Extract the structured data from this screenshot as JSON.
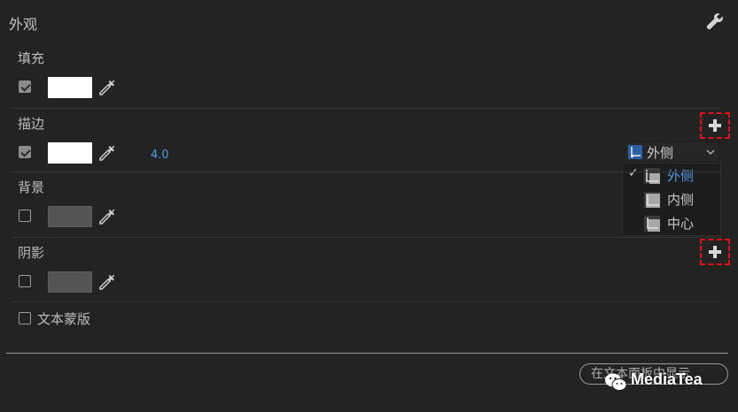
{
  "panel": {
    "title": "外观",
    "settings_icon": "wrench-icon"
  },
  "fill": {
    "label": "填充",
    "checked": true,
    "color": "#ffffff"
  },
  "stroke": {
    "label": "描边",
    "checked": true,
    "color": "#ffffff",
    "width": "4.0",
    "position_select": {
      "selected": "外侧",
      "options": [
        {
          "label": "外侧",
          "selected": true
        },
        {
          "label": "内侧",
          "selected": false
        },
        {
          "label": "中心",
          "selected": false
        }
      ]
    }
  },
  "background": {
    "label": "背景",
    "checked": false,
    "color": "#545454"
  },
  "shadow": {
    "label": "阴影",
    "checked": false,
    "color": "#545454"
  },
  "text_mask": {
    "label": "文本蒙版",
    "checked": false
  },
  "footer": {
    "show_button_label": "在文本面板中显示"
  },
  "watermark": {
    "text": "MediaTea"
  },
  "colors": {
    "accent": "#4d9bea",
    "highlight_box": "#e1131a",
    "panel_bg": "#232323"
  }
}
